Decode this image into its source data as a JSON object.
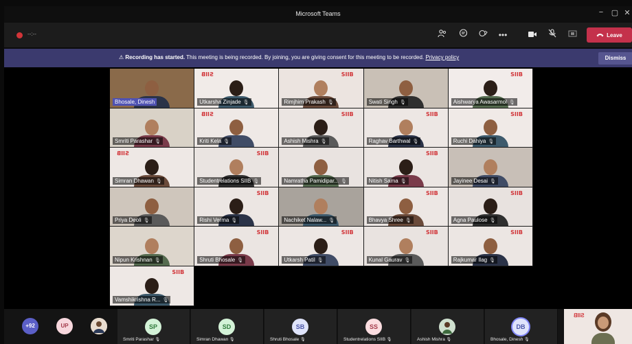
{
  "window": {
    "title": "Microsoft Teams",
    "controls": [
      "−",
      "▢",
      "✕"
    ]
  },
  "toolbar": {
    "timer": "--:--",
    "icons": [
      "people-icon",
      "chat-icon",
      "reactions-icon",
      "more-icon",
      "camera-icon",
      "mic-icon",
      "share-icon"
    ],
    "leave_label": "Leave",
    "colors": {
      "leave": "#c4314b",
      "recording": "#d13438"
    }
  },
  "banner": {
    "headline": "Recording has started.",
    "message": "This meeting is being recorded. By joining, you are giving consent for this meeting to be recorded.",
    "link": "Privacy policy",
    "dismiss": "Dismiss",
    "color": "#3b3a6e"
  },
  "participants": [
    {
      "name": "Bhosale, Dinesh",
      "bg": "#8a6a4a",
      "logo": "",
      "highlight": true
    },
    {
      "name": "Utkarsha Zinjade",
      "bg": "#f1ebe8",
      "logo": "SIIB-mirror"
    },
    {
      "name": "Rimjhim Prakash",
      "bg": "#ece4e0",
      "logo": "SIIB"
    },
    {
      "name": "Swati Singh",
      "bg": "#c9c0b6",
      "logo": ""
    },
    {
      "name": "Aishwarya Awasarmol",
      "bg": "#f2ecea",
      "logo": "SIIB"
    },
    {
      "name": "Smriti Parashar",
      "bg": "#d9d2c7",
      "logo": ""
    },
    {
      "name": "Kriti Kela",
      "bg": "#efe9e6",
      "logo": "SIIB-mirror"
    },
    {
      "name": "Ashish Mishra",
      "bg": "#ebe5e2",
      "logo": "SIIB"
    },
    {
      "name": "Raghav Barthwal",
      "bg": "#ede7e4",
      "logo": "SIIB"
    },
    {
      "name": "Ruchi Dahiya",
      "bg": "#f0eae7",
      "logo": "SIIB"
    },
    {
      "name": "Simran Dhawan",
      "bg": "#eee8e5",
      "logo": "SIIB-mirror"
    },
    {
      "name": "Studentrelations SIIB",
      "bg": "#eae4e1",
      "logo": "SIIB"
    },
    {
      "name": "Namratha Pamidipar...",
      "bg": "#e9e3e0",
      "logo": ""
    },
    {
      "name": "Nitish Sama",
      "bg": "#ebe5e2",
      "logo": "SIIB"
    },
    {
      "name": "Jayinee Desai",
      "bg": "#c8bfb7",
      "logo": ""
    },
    {
      "name": "Priya Deoli",
      "bg": "#cfc6bc",
      "logo": ""
    },
    {
      "name": "Rishi Verma",
      "bg": "#ece6e3",
      "logo": "SIIB"
    },
    {
      "name": "Nachiket Nalaw...",
      "bg": "#a9a39c",
      "logo": ""
    },
    {
      "name": "Bhavya Shree",
      "bg": "#ede7e4",
      "logo": "SIIB"
    },
    {
      "name": "Agna Paulose",
      "bg": "#e8e2df",
      "logo": "SIIB"
    },
    {
      "name": "Nipun Krishnan",
      "bg": "#ddd6cc",
      "logo": ""
    },
    {
      "name": "Shruti Bhosale",
      "bg": "#ebe5e2",
      "logo": "SIIB"
    },
    {
      "name": "Utkarsh Patil",
      "bg": "#ede7e4",
      "logo": "SIIB"
    },
    {
      "name": "Kunal Gaurav",
      "bg": "#e9e3e0",
      "logo": "SIIB"
    },
    {
      "name": "Rajkumar Ilag",
      "bg": "#ece6e3",
      "logo": "SIIB"
    },
    {
      "name": "Vamshikrishna R...",
      "bg": "#eee8e5",
      "logo": "SIIB"
    }
  ],
  "roster": {
    "overflow": "+92",
    "up_initials": "UP",
    "cells": [
      {
        "initials": "SP",
        "name": "Smriti Parashar",
        "color": "#d3f2d7",
        "fg": "#2f7a3b"
      },
      {
        "initials": "SD",
        "name": "Simran Dhawan",
        "color": "#d3f2d7",
        "fg": "#2f7a3b"
      },
      {
        "initials": "SB",
        "name": "Shruti Bhosale",
        "color": "#dfe4fb",
        "fg": "#4b56a8"
      },
      {
        "initials": "SS",
        "name": "Studentrelations SIIB",
        "color": "#fbdde0",
        "fg": "#a33a4a"
      },
      {
        "initials": "",
        "name": "Ashish Mishra",
        "color": "#cfe0cf",
        "fg": "#2f5d2f"
      },
      {
        "initials": "DB",
        "name": "Bhosale, Dinesh",
        "color": "#dfe4fb",
        "fg": "#4b56a8"
      }
    ]
  },
  "logos": {
    "siib": "SIIB",
    "mirror": "SIIB"
  }
}
